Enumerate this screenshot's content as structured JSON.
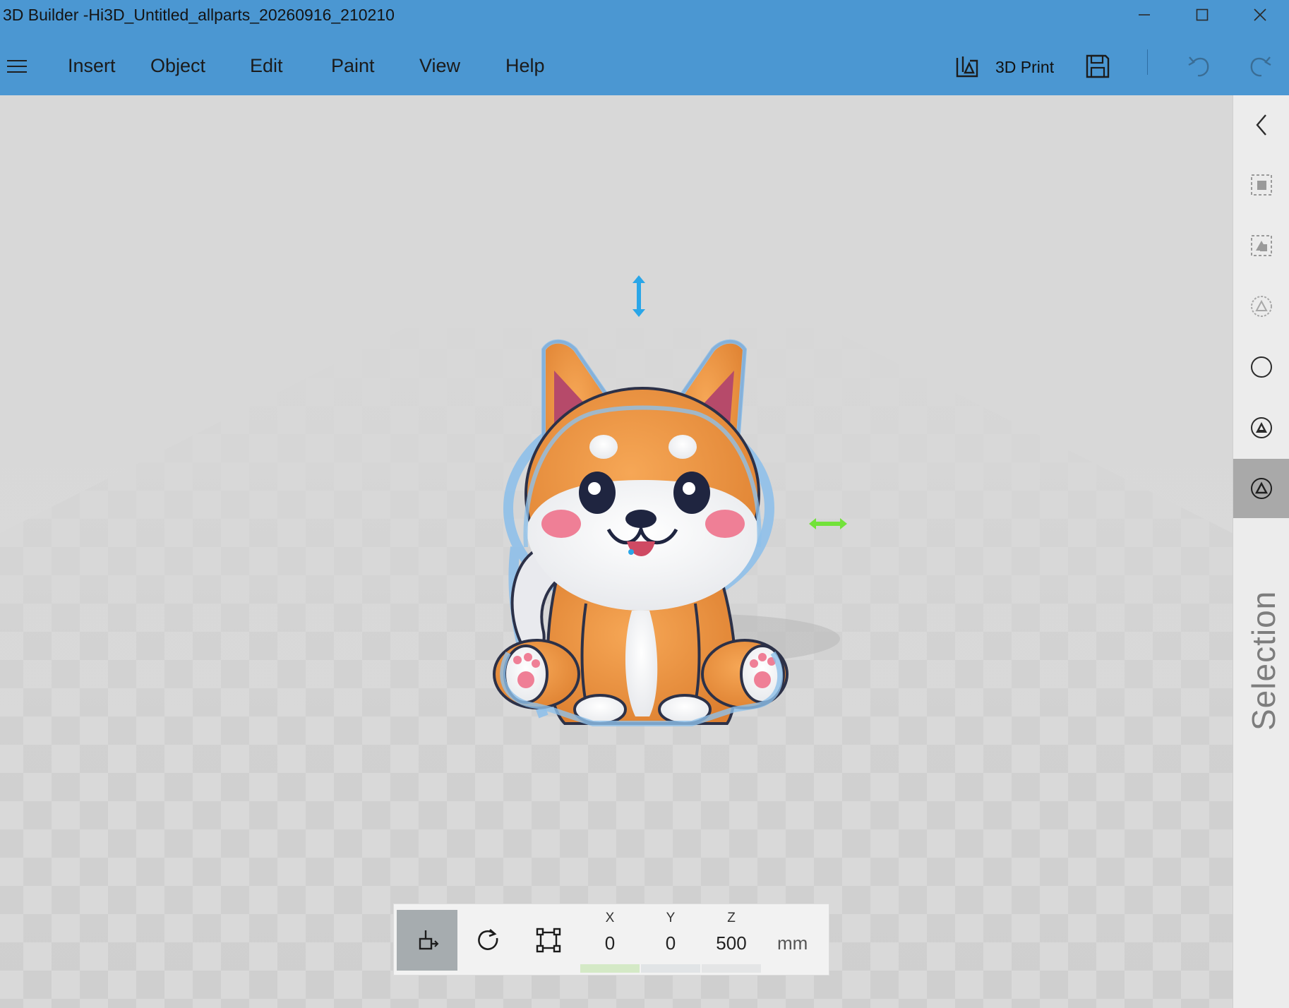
{
  "window": {
    "title": "3D Builder -Hi3D_Untitled_allparts_20260916_210210",
    "controls": [
      "minimize",
      "maximize",
      "close"
    ]
  },
  "menu": {
    "items": [
      "Insert",
      "Object",
      "Edit",
      "Paint",
      "View",
      "Help"
    ]
  },
  "toolbar": {
    "print_label": "3D Print",
    "icons": [
      "3d-print-icon",
      "save-icon",
      "undo-icon",
      "redo-icon"
    ]
  },
  "right_panel": {
    "label": "Selection",
    "buttons": [
      "collapse-chevron",
      "select-objects",
      "select-objects-alt",
      "select-faces",
      "select-vertices",
      "select-edges",
      "select-triangles"
    ],
    "active_button": "select-triangles"
  },
  "transform": {
    "active_tool": "move",
    "labels": {
      "x": "X",
      "y": "Y",
      "z": "Z"
    },
    "values": {
      "x": "0",
      "y": "0",
      "z": "500"
    },
    "unit": "mm"
  },
  "scene": {
    "object": "shiba-inu-model",
    "gizmo_colors": {
      "vertical": "#2aa6e8",
      "horizontal": "#72e23a"
    }
  },
  "colors": {
    "titlebar": "#4b97d2",
    "selection_outline": "#8fc0ea"
  }
}
